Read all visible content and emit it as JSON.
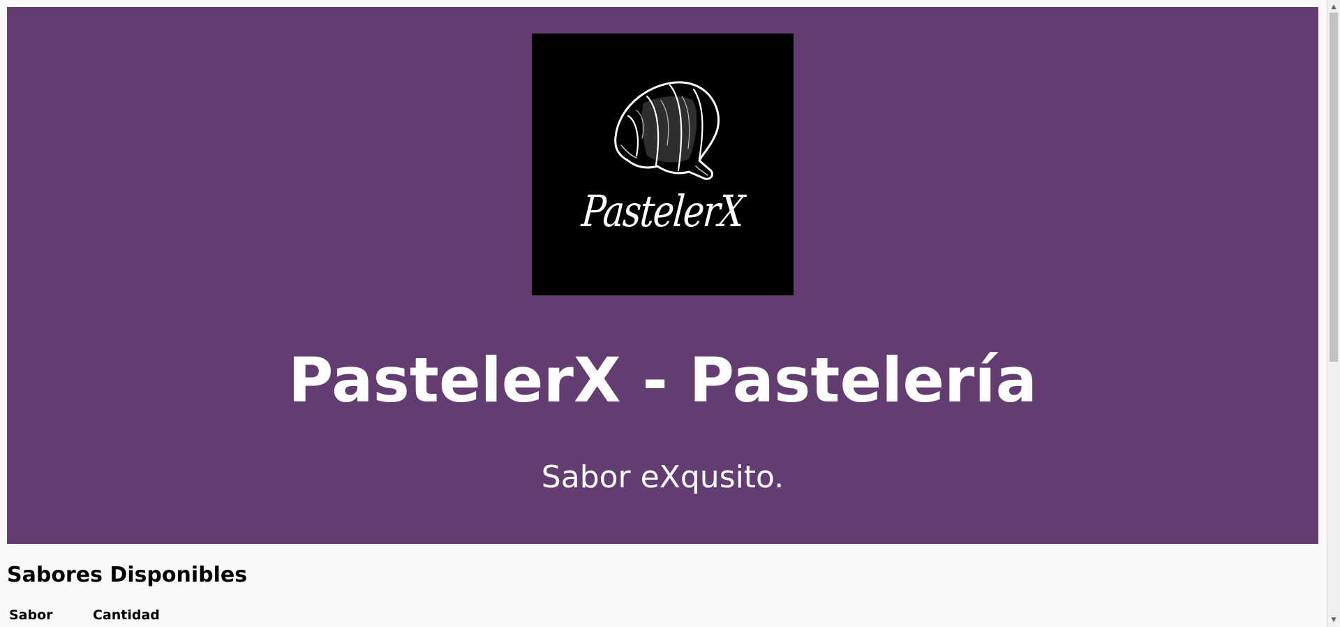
{
  "header": {
    "logo_text": "PastelerX",
    "title": "PastelerX - Pastelería",
    "subtitle": "Sabor eXqusito."
  },
  "flavors": {
    "title": "Sabores Disponibles",
    "columns": [
      "Sabor",
      "Cantidad"
    ]
  },
  "colors": {
    "hero_background": "#633d72",
    "logo_background": "#000000",
    "page_background": "#fafafa"
  },
  "icons": {
    "logo": "croissant-icon",
    "scroll_up": "chevron-up-icon",
    "scroll_down": "chevron-down-icon"
  }
}
